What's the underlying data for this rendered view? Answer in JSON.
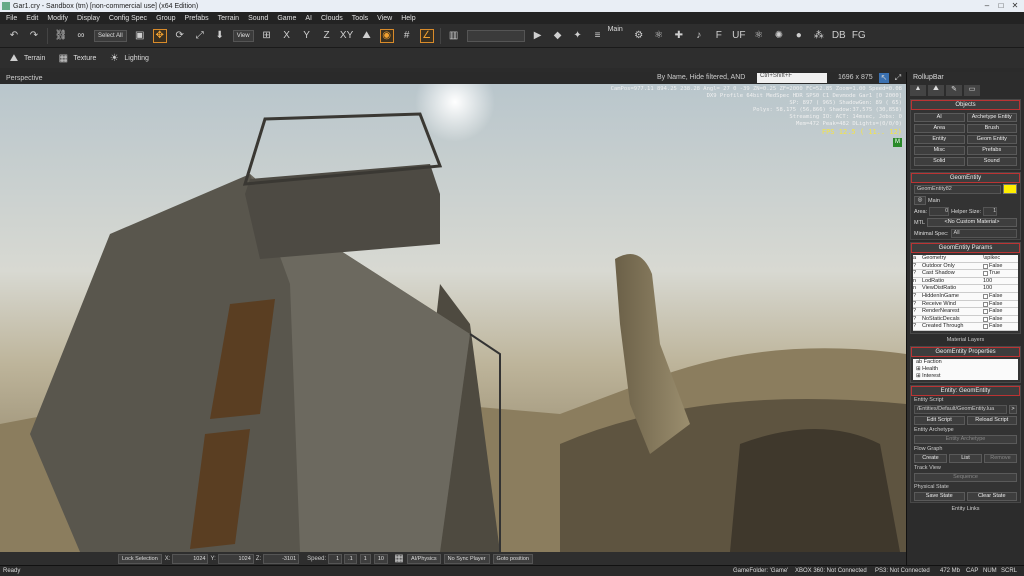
{
  "window": {
    "title": "Gar1.cry - Sandbox (tm) [non-commercial use] (x64 Edition)",
    "minimize": "–",
    "maximize": "□",
    "close": "✕"
  },
  "menu": [
    "File",
    "Edit",
    "Modify",
    "Display",
    "Config Spec",
    "Group",
    "Prefabs",
    "Terrain",
    "Sound",
    "Game",
    "AI",
    "Clouds",
    "Tools",
    "View",
    "Help"
  ],
  "toolbar": {
    "select_all": "Select All",
    "coord_system": "View",
    "axes": [
      "X",
      "Y",
      "Z",
      "XY"
    ],
    "layer": "Main",
    "db": "DB",
    "fg": "FG",
    "f_badge": "F",
    "uf_badge": "UF"
  },
  "toolbar2": {
    "terrain": "Terrain",
    "texture": "Texture",
    "lighting": "Lighting"
  },
  "viewport": {
    "name": "Perspective",
    "filter": "By Name, Hide filtered, AND",
    "search_placeholder": "Ctrl+Shift+F",
    "resolution": "1696 x 875",
    "hud": [
      "CamPos=977.11 894.25 238.28 Angl= 27  0 -39 ZN=0.25 ZF=2000 FC=52.85 Zoom=1.00 Speed=0.08",
      "DX9 Profile 64bit MedSpec HDR SPS0 C1 Devmode Gar1 [0 2000]",
      "SP:  897 ( 965) ShadowGen:  89 ( 65)",
      "Polys: 58,175 (56,866) Shadow:37,575 (30,858)",
      "Streaming IO: ACT: 14msec, Jobs: 0",
      "Mem=472 Peak=482 DLights=(0/0/0)"
    ],
    "fps": "FPS  12.5 ( 11.. 12)",
    "m_badge": "M"
  },
  "rollup": {
    "title": "RollupBar",
    "objects": {
      "title": "Objects",
      "buttons": [
        "AI",
        "Archetype Entity",
        "Area",
        "Brush",
        "Entity",
        "Geom Entity",
        "Misc",
        "Prefabs",
        "Solid",
        "Sound"
      ]
    },
    "geom": {
      "title": "GeomEntity",
      "name": "GeomEntity82",
      "layer": "Main",
      "area_label": "Area:",
      "area": "0",
      "helper_label": "Helper Size:",
      "helper": "1",
      "mtl_label": "MTL",
      "mtl": "<No Custom Material>",
      "minspec_label": "Minimal Spec:",
      "minspec": "All"
    },
    "params": {
      "title": "GeomEntity Params",
      "rows": [
        {
          "n": "Geometry",
          "v": "\\spikec"
        },
        {
          "n": "Outdoor Only",
          "v": "False"
        },
        {
          "n": "Cast Shadow",
          "v": "True"
        },
        {
          "n": "LodRatio",
          "v": "100"
        },
        {
          "n": "ViewDistRatio",
          "v": "100"
        },
        {
          "n": "HiddenInGame",
          "v": "False"
        },
        {
          "n": "Receive Wind",
          "v": "False"
        },
        {
          "n": "RenderNearest",
          "v": "False"
        },
        {
          "n": "NoStaticDecals",
          "v": "False"
        },
        {
          "n": "Created Through",
          "v": "False"
        }
      ]
    },
    "material_layers": "Material Layers",
    "props": {
      "title": "GeomEntity Properties",
      "items": [
        "Faction",
        "Health",
        "Interest"
      ]
    },
    "entity": {
      "title": "Entity: GeomEntity",
      "script_label": "Entity Script",
      "script": "/Entities/Default/GeomEntity.lua",
      "edit": "Edit Script",
      "reload": "Reload Script",
      "arch_label": "Entity Archetype",
      "arch": "Entity Archetype",
      "flow_label": "Flow Graph",
      "create": "Create",
      "list": "List",
      "remove": "Remove",
      "track_label": "Track View",
      "sequence": "Sequence",
      "phys_label": "Physical State",
      "save": "Save State",
      "clear": "Clear State"
    },
    "links": "Entity Links"
  },
  "coords": {
    "lock": "Lock Selection",
    "x_label": "X:",
    "x": "1024",
    "y_label": "Y:",
    "y": "1024",
    "z_label": "Z:",
    "z": "-3101",
    "speed_label": "Speed:",
    "speed": "1",
    "speeds": [
      ".1",
      "1",
      "10"
    ],
    "ai": "AI/Physics",
    "sync": "No Sync Player",
    "goto": "Goto position"
  },
  "status": {
    "ready": "Ready",
    "game_folder": "GameFolder: 'Game'",
    "xbox": "XBOX 360: Not Connected",
    "ps3": "PS3: Not Connected",
    "mem": "472 Mb",
    "cap": "CAP",
    "num": "NUM",
    "scrl": "SCRL"
  }
}
